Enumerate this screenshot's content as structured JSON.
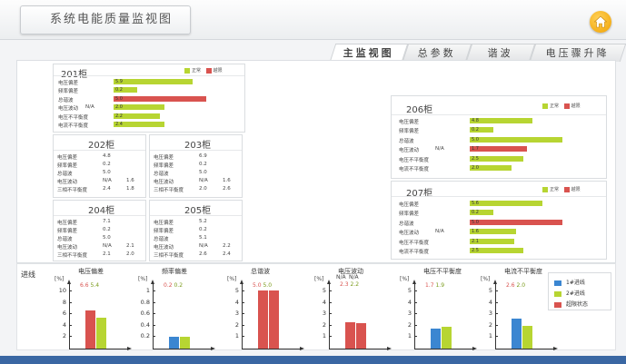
{
  "window": {
    "title": "系统电能质量监视图"
  },
  "tabs": [
    {
      "label": "主监视图",
      "active": true
    },
    {
      "label": "总参数",
      "active": false
    },
    {
      "label": "谐波",
      "active": false
    },
    {
      "label": "电压骤升降",
      "active": false
    }
  ],
  "legend": {
    "normal": "正常",
    "over": "越限"
  },
  "colors": {
    "normal": "#b7d532",
    "over": "#d9534f",
    "line1": "#3b86d1",
    "line2": "#b7d532",
    "limit": "#d9534f"
  },
  "cab201": {
    "title": "201柜",
    "rows": [
      {
        "label": "电压偏差",
        "value": "5.9",
        "fill": 0.85,
        "status": "normal"
      },
      {
        "label": "频率偏差",
        "value": "0.2",
        "fill": 0.25,
        "status": "normal"
      },
      {
        "label": "总谐波",
        "value": "5.0",
        "fill": 1.0,
        "status": "over"
      },
      {
        "label": "电压波动",
        "na": "N/A",
        "value": "2.0",
        "fill": 0.55,
        "status": "normal"
      },
      {
        "label": "电压不平衡度",
        "value": "2.2",
        "fill": 0.5,
        "status": "normal"
      },
      {
        "label": "电流不平衡度",
        "value": "2.4",
        "fill": 0.55,
        "status": "normal"
      }
    ]
  },
  "cab202": {
    "title": "202柜",
    "rows": [
      {
        "label": "电压偏差",
        "v1": "4.8",
        "v2": ""
      },
      {
        "label": "频率偏差",
        "v1": "0.2",
        "v2": ""
      },
      {
        "label": "总谐波",
        "v1": "5.0",
        "v2": ""
      },
      {
        "label": "电压波动",
        "v1": "N/A",
        "v2": "1.6"
      },
      {
        "label": "三相不平衡度",
        "v1": "2.4",
        "v2": "1.8"
      }
    ]
  },
  "cab203": {
    "title": "203柜",
    "rows": [
      {
        "label": "电压偏差",
        "v1": "6.9",
        "v2": ""
      },
      {
        "label": "频率偏差",
        "v1": "0.2",
        "v2": ""
      },
      {
        "label": "总谐波",
        "v1": "5.0",
        "v2": ""
      },
      {
        "label": "电压波动",
        "v1": "N/A",
        "v2": "1.6"
      },
      {
        "label": "三相不平衡度",
        "v1": "2.0",
        "v2": "2.6"
      }
    ]
  },
  "cab204": {
    "title": "204柜",
    "rows": [
      {
        "label": "电压偏差",
        "v1": "7.1",
        "v2": ""
      },
      {
        "label": "频率偏差",
        "v1": "0.2",
        "v2": ""
      },
      {
        "label": "总谐波",
        "v1": "5.0",
        "v2": ""
      },
      {
        "label": "电压波动",
        "v1": "N/A",
        "v2": "2.1"
      },
      {
        "label": "三相不平衡度",
        "v1": "2.1",
        "v2": "2.0"
      }
    ]
  },
  "cab205": {
    "title": "205柜",
    "rows": [
      {
        "label": "电压偏差",
        "v1": "5.2",
        "v2": ""
      },
      {
        "label": "频率偏差",
        "v1": "0.2",
        "v2": ""
      },
      {
        "label": "总谐波",
        "v1": "5.1",
        "v2": ""
      },
      {
        "label": "电压波动",
        "v1": "N/A",
        "v2": "2.2"
      },
      {
        "label": "三相不平衡度",
        "v1": "2.6",
        "v2": "2.4"
      }
    ]
  },
  "cab206": {
    "title": "206柜",
    "rows": [
      {
        "label": "电压偏差",
        "value": "4.8",
        "fill": 0.68,
        "status": "normal"
      },
      {
        "label": "频率偏差",
        "value": "0.2",
        "fill": 0.25,
        "status": "normal"
      },
      {
        "label": "总谐波",
        "value": "5.0",
        "fill": 1.0,
        "status": "normal"
      },
      {
        "label": "电压波动",
        "na": "N/A",
        "value": "1.7",
        "fill": 0.62,
        "status": "over"
      },
      {
        "label": "电压不平衡度",
        "value": "2.5",
        "fill": 0.58,
        "status": "normal"
      },
      {
        "label": "电流不平衡度",
        "value": "2.0",
        "fill": 0.45,
        "status": "normal"
      }
    ]
  },
  "cab207": {
    "title": "207柜",
    "rows": [
      {
        "label": "电压偏差",
        "value": "5.6",
        "fill": 0.78,
        "status": "normal"
      },
      {
        "label": "频率偏差",
        "value": "0.2",
        "fill": 0.25,
        "status": "normal"
      },
      {
        "label": "总谐波",
        "value": "5.0",
        "fill": 1.0,
        "status": "over"
      },
      {
        "label": "电压波动",
        "na": "N/A",
        "value": "1.6",
        "fill": 0.5,
        "status": "normal"
      },
      {
        "label": "电压不平衡度",
        "value": "2.1",
        "fill": 0.48,
        "status": "normal"
      },
      {
        "label": "电流不平衡度",
        "value": "2.5",
        "fill": 0.58,
        "status": "normal"
      }
    ]
  },
  "bottom": {
    "label": "进线",
    "legend": {
      "line1": "1#进线",
      "line2": "2#进线",
      "limit": "超限状态"
    }
  },
  "chart_data": [
    {
      "type": "bar",
      "title": "电压偏差",
      "unit": "[%]",
      "ticks": [
        "10",
        "8",
        "6",
        "4",
        "2"
      ],
      "ylim": [
        0,
        11
      ],
      "readout": [
        "6.6",
        "5.4"
      ],
      "series": [
        {
          "value": 6.6,
          "status": "limit"
        },
        {
          "value": 5.4,
          "status": "line2"
        }
      ]
    },
    {
      "type": "bar",
      "title": "频率偏差",
      "unit": "[%]",
      "ticks": [
        "1",
        "0.8",
        "0.6",
        "0.4",
        "0.2"
      ],
      "ylim": [
        0,
        1.1
      ],
      "readout": [
        "0.2",
        "0.2"
      ],
      "series": [
        {
          "value": 0.2,
          "status": "line1"
        },
        {
          "value": 0.2,
          "status": "line2"
        }
      ]
    },
    {
      "type": "bar",
      "title": "总谐波",
      "unit": "[%]",
      "ticks": [
        "5",
        "4",
        "3",
        "2",
        "1"
      ],
      "ylim": [
        0,
        5.5
      ],
      "readout": [
        "5.0",
        "5.0"
      ],
      "series": [
        {
          "value": 5.0,
          "status": "limit"
        },
        {
          "value": 5.0,
          "status": "limit"
        }
      ]
    },
    {
      "type": "bar",
      "title": "电压波动",
      "unit": "[%]",
      "ticks": [
        "5",
        "4",
        "3",
        "2",
        "1"
      ],
      "ylim": [
        0,
        5.5
      ],
      "na": [
        "N/A",
        "N/A"
      ],
      "readout": [
        "2.3",
        "2.2"
      ],
      "series": [
        {
          "value": 2.3,
          "status": "limit"
        },
        {
          "value": 2.2,
          "status": "limit"
        }
      ]
    },
    {
      "type": "bar",
      "title": "电压不平衡度",
      "unit": "[%]",
      "ticks": [
        "5",
        "4",
        "3",
        "2",
        "1"
      ],
      "ylim": [
        0,
        5.5
      ],
      "readout": [
        "1.7",
        "1.9"
      ],
      "series": [
        {
          "value": 1.7,
          "status": "line1"
        },
        {
          "value": 1.9,
          "status": "line2"
        }
      ]
    },
    {
      "type": "bar",
      "title": "电流不平衡度",
      "unit": "[%]",
      "ticks": [
        "5",
        "4",
        "3",
        "2",
        "1"
      ],
      "ylim": [
        0,
        5.5
      ],
      "readout": [
        "2.6",
        "2.0"
      ],
      "series": [
        {
          "value": 2.6,
          "status": "line1"
        },
        {
          "value": 2.0,
          "status": "line2"
        }
      ]
    }
  ]
}
